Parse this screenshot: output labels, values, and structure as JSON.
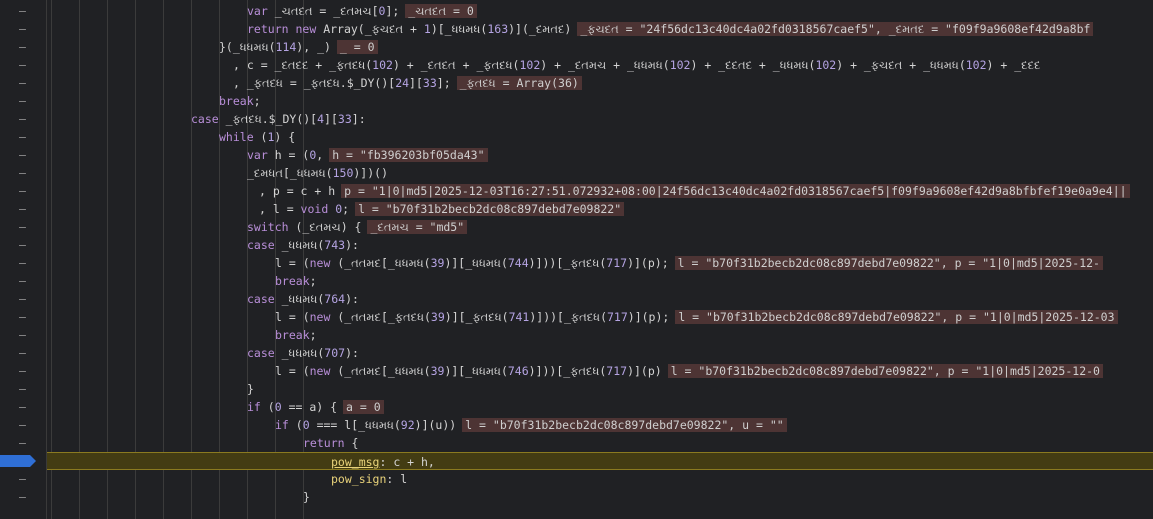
{
  "breakpoint_line_index": 25,
  "lines": [
    {
      "indent": 200,
      "code": "var _ચતદત = _દતમચ[0];",
      "inline": "_ચતદત = 0"
    },
    {
      "indent": 200,
      "code": "return new Array(_ફચદત + 1)[_ધધમધ(163)](_દમતદ)",
      "inline": "_ફચદત = \"24f56dc13c40dc4a02fd0318567caef5\", _દમતદ = \"f09f9a9608ef42d9a8bf"
    },
    {
      "indent": 172,
      "code": "}(_ધધમધ(114), _)",
      "inline": "_ = 0"
    },
    {
      "indent": 186,
      "code": ", c = _દતદદ + _ફતદધ(102) + _દતદત + _ફતદધ(102) + _દતમચ + _ધધમધ(102) + _દદતદ + _ધધમધ(102) + _ફચદત + _ધધમધ(102) + _દદદ",
      "inline": ""
    },
    {
      "indent": 186,
      "code": ", _ફતદધ = _ફતદધ.$_DY()[24][33];",
      "inline": "_ફતદધ = Array(36)"
    },
    {
      "indent": 172,
      "code": "break;",
      "inline": ""
    },
    {
      "indent": 144,
      "code": "case _ફતદધ.$_DY()[4][33]:",
      "inline": ""
    },
    {
      "indent": 172,
      "code": "while (1) {",
      "inline": ""
    },
    {
      "indent": 200,
      "code": "var h = (0,",
      "inline": "h = \"fb396203bf05da43\""
    },
    {
      "indent": 200,
      "code": "_દમધત[_ધધમધ(150)])()",
      "inline": ""
    },
    {
      "indent": 212,
      "code": ", p = c + h",
      "inline": "p = \"1|0|md5|2025-12-03T16:27:51.072932+08:00|24f56dc13c40dc4a02fd0318567caef5|f09f9a9608ef42d9a8bfbfef19e0a9e4||"
    },
    {
      "indent": 212,
      "code": ", l = void 0;",
      "inline": "l = \"b70f31b2becb2dc08c897debd7e09822\""
    },
    {
      "indent": 200,
      "code": "switch (_દતમચ) {",
      "inline": "_દતમચ = \"md5\""
    },
    {
      "indent": 200,
      "code": "case _ધધમધ(743):",
      "inline": ""
    },
    {
      "indent": 228,
      "code": "l = (new (_તતમદ[_ધધમધ(39)][_ધધમધ(744)]))[_ફતદધ(717)](p);",
      "inline": "l = \"b70f31b2becb2dc08c897debd7e09822\", p = \"1|0|md5|2025-12-"
    },
    {
      "indent": 228,
      "code": "break;",
      "inline": ""
    },
    {
      "indent": 200,
      "code": "case _ધધમધ(764):",
      "inline": ""
    },
    {
      "indent": 228,
      "code": "l = (new (_તતમદ[_ફતદધ(39)][_ફતદધ(741)]))[_ફતદધ(717)](p);",
      "inline": "l = \"b70f31b2becb2dc08c897debd7e09822\", p = \"1|0|md5|2025-12-03"
    },
    {
      "indent": 228,
      "code": "break;",
      "inline": ""
    },
    {
      "indent": 200,
      "code": "case _ધધમધ(707):",
      "inline": ""
    },
    {
      "indent": 228,
      "code": "l = (new (_તતમદ[_ધધમધ(39)][_ધધમધ(746)]))[_ફતદધ(717)](p)",
      "inline": "l = \"b70f31b2becb2dc08c897debd7e09822\", p = \"1|0|md5|2025-12-0"
    },
    {
      "indent": 200,
      "code": "}",
      "inline": ""
    },
    {
      "indent": 200,
      "code": "if (0 == a) {",
      "inline": "a = 0"
    },
    {
      "indent": 228,
      "code": "if (0 === l[_ધધમધ(92)](u))",
      "inline": "l = \"b70f31b2becb2dc08c897debd7e09822\", u = \"\""
    },
    {
      "indent": 256,
      "code": "return {",
      "inline": ""
    },
    {
      "indent": 284,
      "code": "pow_msg: c + h,",
      "inline": ""
    },
    {
      "indent": 284,
      "code": "pow_sign: l",
      "inline": ""
    },
    {
      "indent": 256,
      "code": "}",
      "inline": ""
    }
  ]
}
